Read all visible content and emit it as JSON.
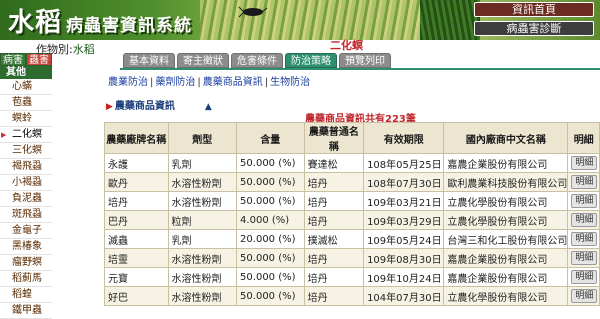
{
  "banner": {
    "title_main": "水稻",
    "title_sub": "病蟲害資訊系統",
    "btn_home": "資訊首頁",
    "btn_diag": "病蟲害診斷"
  },
  "crop": {
    "prefix": "作物別:",
    "name": "水稻"
  },
  "sidebar": {
    "tabs": [
      "病害",
      "蟲害"
    ],
    "header": "其他",
    "items": [
      "心蟎",
      "苞蟲",
      "螟蛉",
      "二化螟",
      "三化螟",
      "褐飛蝨",
      "小褐蝨",
      "負泥蟲",
      "斑飛蝨",
      "金龜子",
      "黑椿象",
      "瘤野螟",
      "稻薊馬",
      "稻蝗",
      "鐵甲蟲"
    ],
    "selected_index": 3
  },
  "pest": "二化螟",
  "tabs": [
    "基本資料",
    "寄主徵狀",
    "危害條件",
    "防治策略",
    "預覽列印"
  ],
  "subnav": [
    "農業防治",
    "藥劑防治",
    "農藥商品資訊",
    "生物防治"
  ],
  "subhead": "農藥商品資訊",
  "count": "農藥商品資訊共有223筆",
  "table": {
    "headers": [
      "農藥廠牌名稱",
      "劑型",
      "含量",
      "農藥普通名稱",
      "有效期限",
      "國內廠商中文名稱",
      "明細"
    ],
    "rows": [
      [
        "永護",
        "乳劑",
        "50.000 (%)",
        "賽達松",
        "108年05月25日",
        "嘉農企業股份有限公司",
        "明細"
      ],
      [
        "歐丹",
        "水溶性粉劑",
        "50.000 (%)",
        "培丹",
        "108年07月30日",
        "歐利農業科技股份有限公司",
        "明細"
      ],
      [
        "培丹",
        "水溶性粉劑",
        "50.000 (%)",
        "培丹",
        "109年03月21日",
        "立農化學股份有限公司",
        "明細"
      ],
      [
        "巴丹",
        "粒劑",
        "4.000 (%)",
        "培丹",
        "109年03月29日",
        "立農化學股份有限公司",
        "明細"
      ],
      [
        "滅蟲",
        "乳劑",
        "20.000 (%)",
        "撲滅松",
        "109年05月24日",
        "台灣三和化工股份有限公司",
        "明細"
      ],
      [
        "培靈",
        "水溶性粉劑",
        "50.000 (%)",
        "培丹",
        "109年08月30日",
        "嘉農企業股份有限公司",
        "明細"
      ],
      [
        "元寶",
        "水溶性粉劑",
        "50.000 (%)",
        "培丹",
        "109年10月24日",
        "嘉農企業股份有限公司",
        "明細"
      ],
      [
        "好巴",
        "水溶性粉劑",
        "50.000 (%)",
        "培丹",
        "104年07月30日",
        "立農化學股份有限公司",
        "明細"
      ]
    ]
  }
}
